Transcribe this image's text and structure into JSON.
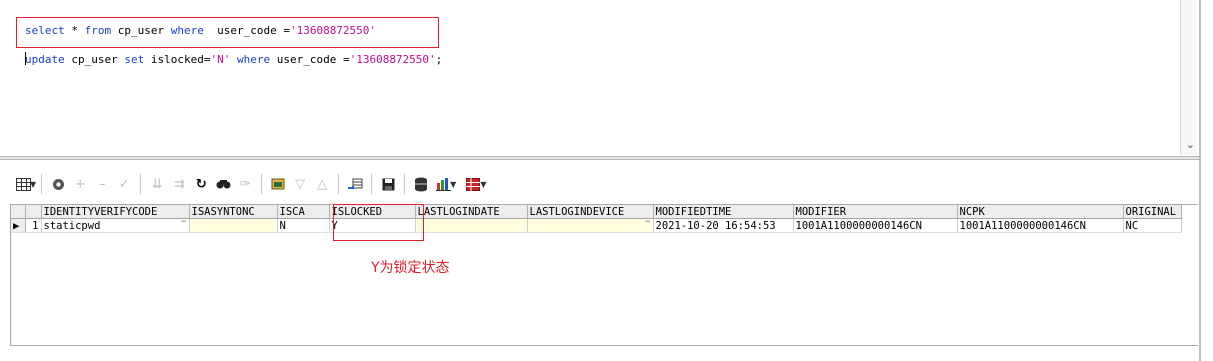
{
  "editor": {
    "line1": {
      "kw_select": "select",
      "star": " * ",
      "kw_from": "from",
      "table": " cp_user ",
      "kw_where": "where",
      "rest": "  user_code =",
      "value": "'13608872550'"
    },
    "line2": {
      "kw_update": "update",
      "table": " cp_user ",
      "kw_set": "set",
      "assign": " islocked=",
      "assign_val": "'N'",
      "space": " ",
      "kw_where": "where",
      "rest": " user_code =",
      "value": "'13608872550'",
      "end": ";"
    }
  },
  "toolbar": {
    "icons": [
      "grid-icon",
      "lock-icon",
      "add-icon",
      "remove-icon",
      "post-icon",
      "filter-down-icon",
      "filter-up-icon",
      "refresh-icon",
      "find-icon",
      "clear-icon",
      "query-icon",
      "arrow-down-icon",
      "arrow-up-icon",
      "export-icon",
      "save-icon",
      "database-icon",
      "chart-icon",
      "table-icon"
    ]
  },
  "grid": {
    "columns": [
      "IDENTITYVERIFYCODE",
      "ISASYNTONC",
      "ISCA",
      "ISLOCKED",
      "LASTLOGINDATE",
      "LASTLOGINDEVICE",
      "MODIFIEDTIME",
      "MODIFIER",
      "NCPK",
      "ORIGINAL"
    ],
    "rows": [
      {
        "num": "1",
        "cells": [
          "staticpwd",
          "",
          "N",
          "Y",
          "",
          "",
          "2021-10-20 16:54:53",
          "1001A1100000000146CN",
          "1001A1100000000146CN",
          "NC"
        ]
      }
    ]
  },
  "annotation": {
    "note": "Y为锁定状态"
  },
  "colors": {
    "keyword": "#1a3ec8",
    "string": "#c01090",
    "highlight": "#e0202a",
    "cell_yellow": "#ffffe0"
  }
}
